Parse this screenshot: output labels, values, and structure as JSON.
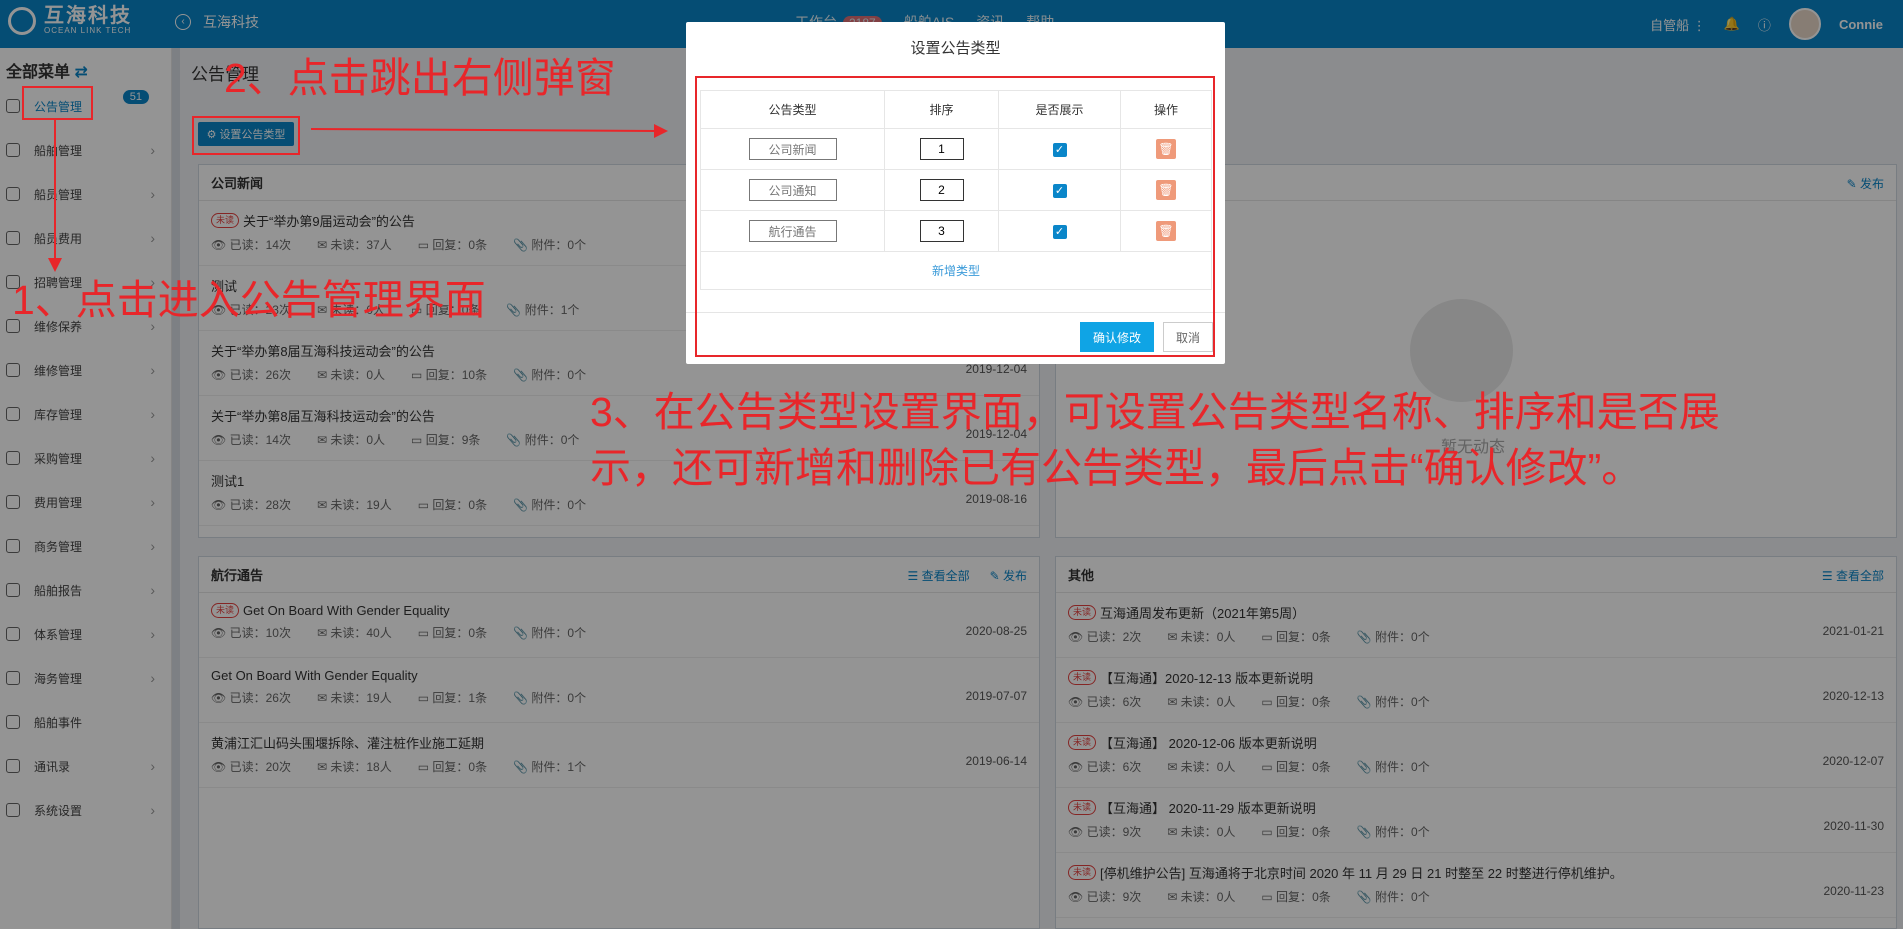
{
  "topbar": {
    "logo_cn": "互海科技",
    "logo_en": "OCEAN LINK TECH",
    "back_title": "互海科技",
    "nav": [
      "工作台",
      "船舶AIS",
      "资讯",
      "帮助"
    ],
    "workbench_badge": "2187",
    "ship_label": "自管船",
    "user": "Connie"
  },
  "sidebar": {
    "header": "全部菜单",
    "badge": "51",
    "items": [
      {
        "label": "公告管理",
        "icon": "book-icon"
      },
      {
        "label": "船舶管理",
        "icon": "anchor-icon"
      },
      {
        "label": "船员管理",
        "icon": "user-icon"
      },
      {
        "label": "船员费用",
        "icon": "wallet-icon"
      },
      {
        "label": "招聘管理",
        "icon": "recruit-icon"
      },
      {
        "label": "维修保养",
        "icon": "tool-icon"
      },
      {
        "label": "维修管理",
        "icon": "wrench-icon"
      },
      {
        "label": "库存管理",
        "icon": "home-icon"
      },
      {
        "label": "采购管理",
        "icon": "cart-icon"
      },
      {
        "label": "费用管理",
        "icon": "coins-icon"
      },
      {
        "label": "商务管理",
        "icon": "globe-icon"
      },
      {
        "label": "船舶报告",
        "icon": "calendar-icon"
      },
      {
        "label": "体系管理",
        "icon": "doc-icon"
      },
      {
        "label": "海务管理",
        "icon": "sign-icon"
      },
      {
        "label": "船舶事件",
        "icon": "warning-icon"
      },
      {
        "label": "通讯录",
        "icon": "contacts-icon"
      },
      {
        "label": "系统设置",
        "icon": "gear-icon"
      }
    ]
  },
  "page": {
    "breadcrumb": "公告管理",
    "set_type_button": "设置公告类型",
    "view_all": "查看全部",
    "publish": "发布",
    "empty": "暂无动态"
  },
  "labels": {
    "read": "已读：",
    "unread_count": "未读：",
    "reply": "回复：",
    "attach": "附件：",
    "unread_tag": "未读"
  },
  "panels": {
    "company_news": {
      "title": "公司新闻",
      "rows": [
        {
          "unread": true,
          "title": "关于“举办第9届运动会”的公告",
          "read": "14次",
          "unread_n": "37人",
          "reply": "0条",
          "attach": "0个",
          "date": ""
        },
        {
          "unread": false,
          "title": "测试",
          "read": "23次",
          "unread_n": "0人",
          "reply": "0条",
          "attach": "1个",
          "date": ""
        },
        {
          "unread": false,
          "title": "关于“举办第8届互海科技运动会”的公告",
          "read": "26次",
          "unread_n": "0人",
          "reply": "10条",
          "attach": "0个",
          "date": "2019-12-04"
        },
        {
          "unread": false,
          "title": "关于“举办第8届互海科技运动会”的公告",
          "read": "14次",
          "unread_n": "0人",
          "reply": "9条",
          "attach": "0个",
          "date": "2019-12-04"
        },
        {
          "unread": false,
          "title": "测试1",
          "read": "28次",
          "unread_n": "19人",
          "reply": "0条",
          "attach": "0个",
          "date": "2019-08-16"
        }
      ]
    },
    "voyage": {
      "title": "航行通告",
      "rows": [
        {
          "unread": true,
          "title": "Get On Board With Gender Equality",
          "read": "10次",
          "unread_n": "40人",
          "reply": "0条",
          "attach": "0个",
          "date": "2020-08-25"
        },
        {
          "unread": false,
          "title": "Get On Board With Gender Equality",
          "read": "26次",
          "unread_n": "19人",
          "reply": "1条",
          "attach": "0个",
          "date": "2019-07-07"
        },
        {
          "unread": false,
          "title": "黄浦江汇山码头围堰拆除、灌注桩作业施工延期",
          "read": "20次",
          "unread_n": "18人",
          "reply": "0条",
          "attach": "1个",
          "date": "2019-06-14"
        }
      ]
    },
    "other": {
      "title": "其他",
      "rows": [
        {
          "unread": true,
          "title": "互海通周发布更新（2021年第5周）",
          "read": "2次",
          "unread_n": "0人",
          "reply": "0条",
          "attach": "0个",
          "date": "2021-01-21"
        },
        {
          "unread": true,
          "title": "【互海通】2020-12-13 版本更新说明",
          "read": "6次",
          "unread_n": "0人",
          "reply": "0条",
          "attach": "0个",
          "date": "2020-12-13"
        },
        {
          "unread": true,
          "title": "【互海通】 2020-12-06 版本更新说明",
          "read": "6次",
          "unread_n": "0人",
          "reply": "0条",
          "attach": "0个",
          "date": "2020-12-07"
        },
        {
          "unread": true,
          "title": "【互海通】 2020-11-29 版本更新说明",
          "read": "9次",
          "unread_n": "0人",
          "reply": "0条",
          "attach": "0个",
          "date": "2020-11-30"
        },
        {
          "unread": true,
          "title": "[停机维护公告] 互海通将于北京时间 2020 年 11 月 29 日 21 时整至 22 时整进行停机维护。",
          "read": "9次",
          "unread_n": "0人",
          "reply": "0条",
          "attach": "0个",
          "date": "2020-11-23"
        }
      ]
    }
  },
  "modal": {
    "title": "设置公告类型",
    "headers": [
      "公告类型",
      "排序",
      "是否展示",
      "操作"
    ],
    "rows": [
      {
        "name": "公司新闻",
        "order": "1",
        "show": true
      },
      {
        "name": "公司通知",
        "order": "2",
        "show": true
      },
      {
        "name": "航行通告",
        "order": "3",
        "show": true
      }
    ],
    "add_type": "新增类型",
    "confirm": "确认修改",
    "cancel": "取消"
  },
  "annotations": {
    "step1": "1、点击进入公告管理界面",
    "step2": "2、点击跳出右侧弹窗",
    "step3_line1": "3、在公告类型设置界面，可设置公告类型名称、排序和是否展",
    "step3_line2": "示，还可新增和删除已有公告类型，最后点击“确认修改”。",
    "color": "#e8262a"
  },
  "colors": {
    "brand": "#0a86c9",
    "danger": "#e64340"
  }
}
